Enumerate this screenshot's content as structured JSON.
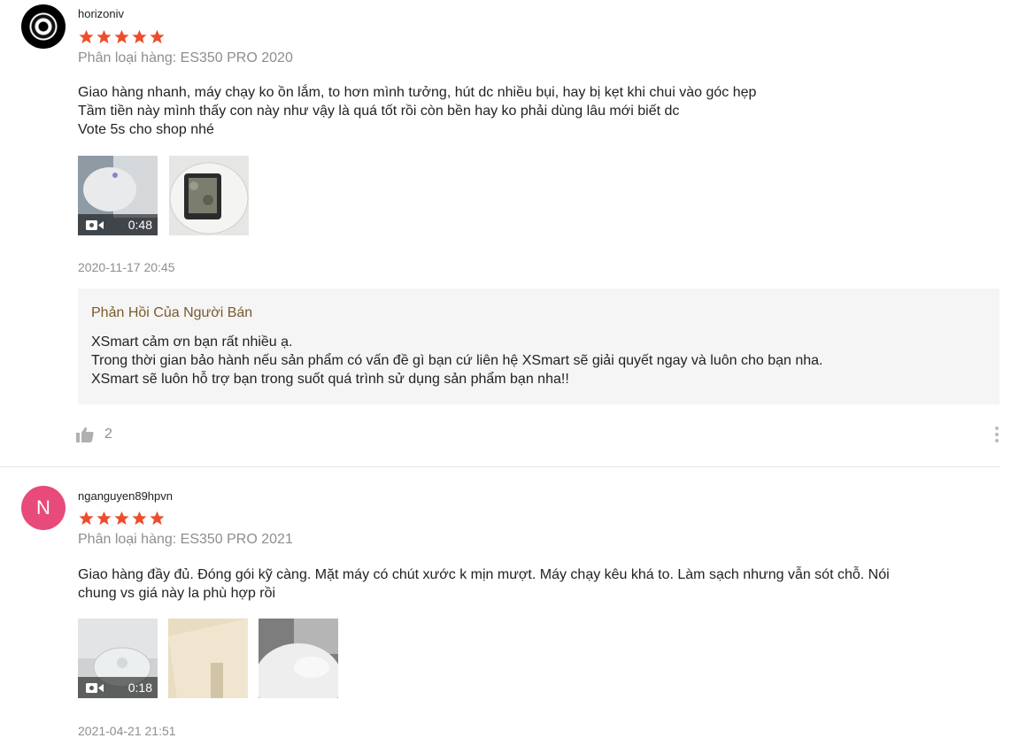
{
  "reviews": [
    {
      "username": "horizoniv",
      "rating": 5,
      "variant": "Phân loại hàng: ES350 PRO 2020",
      "content_lines": [
        "Giao hàng nhanh, máy chạy ko ồn lắm, to hơn mình tưởng, hút dc nhiều bụi, hay bị kẹt khi chui vào góc hẹp",
        "Tầm tiền này mình thấy con này như vậy là quá tốt rồi còn bền hay ko phải dùng lâu mới biết dc",
        "Vote 5s cho shop nhé"
      ],
      "media": [
        {
          "type": "video",
          "duration": "0:48"
        },
        {
          "type": "image"
        }
      ],
      "timestamp": "2020-11-17 20:45",
      "seller_reply": {
        "title": "Phản Hồi Của Người Bán",
        "lines": [
          "XSmart cảm ơn bạn rất nhiều ạ.",
          "Trong thời gian bảo hành nếu sản phẩm có vấn đề gì bạn cứ liên hệ XSmart sẽ giải quyết ngay và luôn cho bạn nha.",
          "XSmart sẽ luôn hỗ trợ bạn trong suốt quá trình sử dụng sản phẩm bạn nha!!"
        ]
      },
      "likes": "2"
    },
    {
      "username": "nganguyen89hpvn",
      "avatar_letter": "N",
      "rating": 5,
      "variant": "Phân loại hàng: ES350 PRO 2021",
      "content_lines": [
        "Giao hàng đầy đủ. Đóng gói kỹ càng. Mặt máy có chút xước k mịn mượt. Máy chạy kêu khá to. Làm sạch nhưng vẫn sót chỗ. Nói",
        "chung vs giá này la phù hợp rồi"
      ],
      "media": [
        {
          "type": "video",
          "duration": "0:18"
        },
        {
          "type": "image"
        },
        {
          "type": "image"
        }
      ],
      "timestamp": "2021-04-21 21:51"
    }
  ],
  "colors": {
    "star": "#ee4d2d",
    "seller_reply_title": "#7a5a2e",
    "muted": "#8e8e8e"
  }
}
